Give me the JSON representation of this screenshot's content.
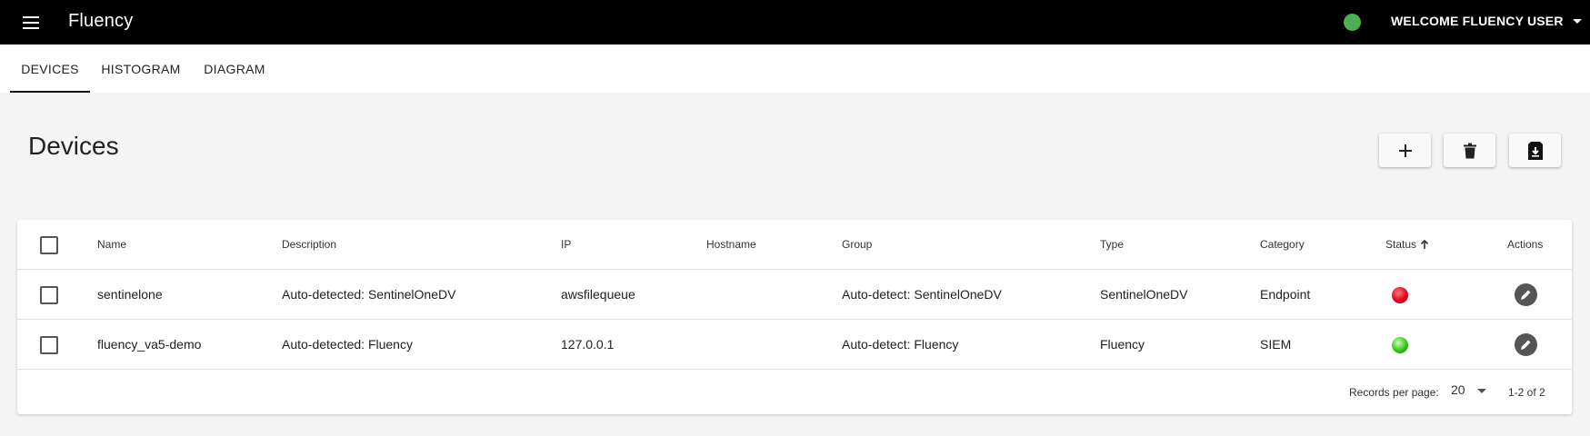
{
  "app": {
    "title": "Fluency",
    "user_label": "WELCOME FLUENCY USER",
    "status_color": "#4caf50"
  },
  "tabs": [
    {
      "label": "DEVICES",
      "active": true
    },
    {
      "label": "HISTOGRAM",
      "active": false
    },
    {
      "label": "DIAGRAM",
      "active": false
    }
  ],
  "page": {
    "title": "Devices"
  },
  "toolbar": {
    "add_icon": "plus-icon",
    "delete_icon": "trash-icon",
    "export_icon": "file-download-icon"
  },
  "table": {
    "columns": [
      "Name",
      "Description",
      "IP",
      "Hostname",
      "Group",
      "Type",
      "Category",
      "Status",
      "Actions"
    ],
    "sort": {
      "column": "Status",
      "direction": "ascending"
    },
    "rows": [
      {
        "name": "sentinelone",
        "description": "Auto-detected: SentinelOneDV",
        "ip": "awsfilequeue",
        "hostname": "",
        "group": "Auto-detect: SentinelOneDV",
        "type": "SentinelOneDV",
        "category": "Endpoint",
        "status": "red"
      },
      {
        "name": "fluency_va5-demo",
        "description": "Auto-detected: Fluency",
        "ip": "127.0.0.1",
        "hostname": "",
        "group": "Auto-detect: Fluency",
        "type": "Fluency",
        "category": "SIEM",
        "status": "green"
      }
    ]
  },
  "pagination": {
    "records_label": "Records per page:",
    "per_page": "20",
    "range": "1-2 of 2"
  }
}
